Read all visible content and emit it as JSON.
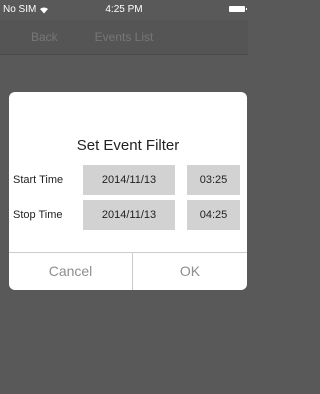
{
  "status_bar": {
    "carrier": "No SIM",
    "time": "4:25 PM"
  },
  "nav": {
    "back_label": "Back",
    "title": "Events List"
  },
  "dialog": {
    "title": "Set Event Filter",
    "start": {
      "label": "Start Time",
      "date": "2014/11/13",
      "time": "03:25"
    },
    "stop": {
      "label": "Stop Time",
      "date": "2014/11/13",
      "time": "04:25"
    },
    "cancel_label": "Cancel",
    "ok_label": "OK"
  }
}
